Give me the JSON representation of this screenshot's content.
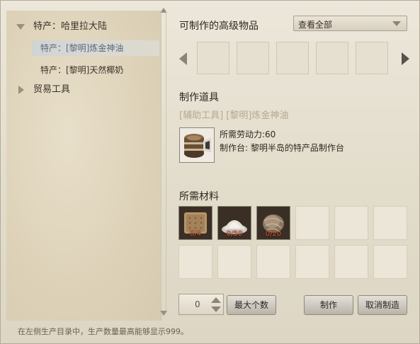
{
  "sidebar": {
    "categories": [
      {
        "label": "特产：哈里拉大陆",
        "expanded": true
      },
      {
        "label": "贸易工具",
        "expanded": false
      }
    ],
    "items": [
      {
        "label": "特产：[黎明]炼金神油",
        "selected": true,
        "color": "#5b6a7d"
      },
      {
        "label": "特产：[黎明]天然椰奶",
        "selected": false,
        "color": "#3a3128"
      }
    ],
    "hint": "在左侧生产目录中，生产数量最高能够显示999。"
  },
  "advanced": {
    "title": "可制作的高级物品",
    "filter_value": "查看全部",
    "slot_count": 5
  },
  "tool": {
    "section_title": "制作道具",
    "name": "[辅助工具] [黎明]炼金神油",
    "labor": "所需劳动力:60",
    "station": "制作台: 黎明半岛的特产品制作台",
    "icon": "barrel-icon"
  },
  "materials": {
    "section_title": "所需材料",
    "items": [
      {
        "icon": "cracker-icon",
        "count": "0/4"
      },
      {
        "icon": "flour-pile-icon",
        "count": "0/50"
      },
      {
        "icon": "fiber-bundle-icon",
        "count": "0/20"
      }
    ],
    "total_slots": 12
  },
  "controls": {
    "quantity": "0",
    "max_label": "最大个数",
    "craft_label": "制作",
    "cancel_label": "取消制造"
  },
  "colors": {
    "count_red": "#e25a3a",
    "muted_tool_name": "#b7a88e"
  }
}
